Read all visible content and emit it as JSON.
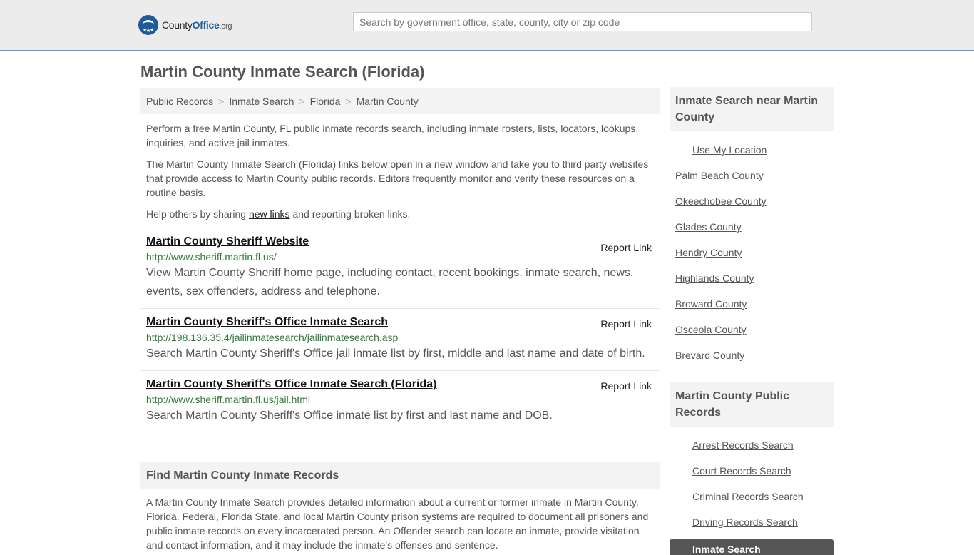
{
  "header": {
    "logo_main": "County",
    "logo_accent": "Office",
    "logo_suffix": ".org",
    "search_placeholder": "Search by government office, state, county, city or zip code"
  },
  "page_title": "Martin County Inmate Search (Florida)",
  "breadcrumb": [
    "Public Records",
    "Inmate Search",
    "Florida",
    "Martin County"
  ],
  "intro": {
    "p1": "Perform a free Martin County, FL public inmate records search, including inmate rosters, lists, locators, lookups, inquiries, and active jail inmates.",
    "p2": "The Martin County Inmate Search (Florida) links below open in a new window and take you to third party websites that provide access to Martin County public records. Editors frequently monitor and verify these resources on a routine basis.",
    "p3_before": "Help others by sharing ",
    "p3_link": "new links",
    "p3_after": " and reporting broken links."
  },
  "links": [
    {
      "title": "Martin County Sheriff Website",
      "report": "Report Link",
      "url": "http://www.sheriff.martin.fl.us/",
      "desc": "View Martin County Sheriff home page, including contact, recent bookings, inmate search, news, events, sex offenders, address and telephone."
    },
    {
      "title": "Martin County Sheriff's Office Inmate Search",
      "report": "Report Link",
      "url": "http://198.136.35.4/jailinmatesearch/jailinmatesearch.asp",
      "desc": "Search Martin County Sheriff's Office jail inmate list by first, middle and last name and date of birth."
    },
    {
      "title": "Martin County Sheriff's Office Inmate Search (Florida)",
      "report": "Report Link",
      "url": "http://www.sheriff.martin.fl.us/jail.html",
      "desc": "Search Martin County Sheriff's Office inmate list by first and last name and DOB."
    }
  ],
  "find": {
    "heading": "Find Martin County Inmate Records",
    "body": "A Martin County Inmate Search provides detailed information about a current or former inmate in Martin County, Florida. Federal, Florida State, and local Martin County prison systems are required to document all prisoners and public inmate records on every incarcerated person. An Offender search can locate an inmate, provide visitation and contact information, and it may include the inmate's offenses and sentence."
  },
  "sidebar": {
    "near_heading": "Inmate Search near Martin County",
    "use_location": "Use My Location",
    "near_items": [
      "Palm Beach County",
      "Okeechobee County",
      "Glades County",
      "Hendry County",
      "Highlands County",
      "Broward County",
      "Osceola County",
      "Brevard County"
    ],
    "records_heading": "Martin County Public Records",
    "records_items": [
      "Arrest Records Search",
      "Court Records Search",
      "Criminal Records Search",
      "Driving Records Search"
    ],
    "active_item": "Inmate Search"
  }
}
